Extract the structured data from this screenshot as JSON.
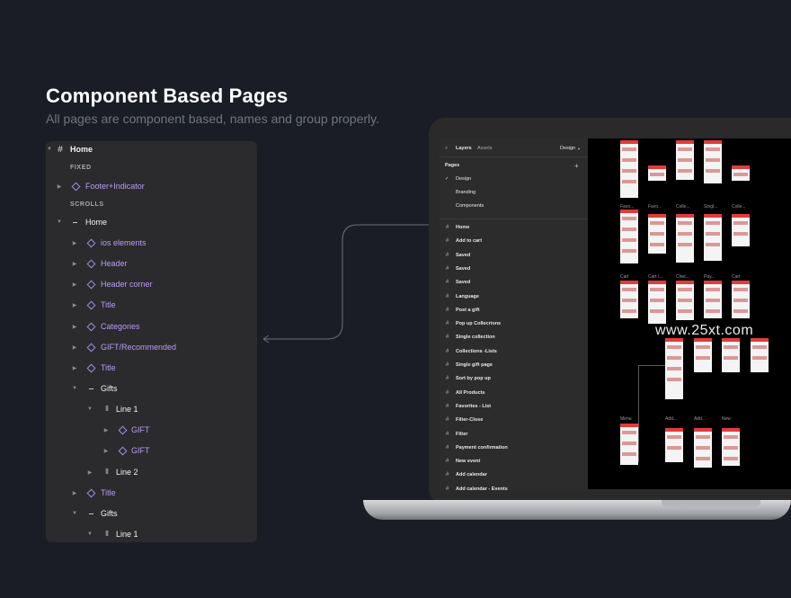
{
  "header": {
    "title": "Component Based Pages",
    "subtitle": "All pages are component based,  names and group properly."
  },
  "layers_panel": {
    "rows": [
      {
        "label": "Home",
        "style": "white-bold",
        "icon": "frame-icon"
      },
      {
        "label": "FIXED",
        "style": "section"
      },
      {
        "label": "Footer+Indicator",
        "style": "purple",
        "icon": "component-icon"
      },
      {
        "label": "SCROLLS",
        "style": "section"
      },
      {
        "label": "Home",
        "style": "white",
        "icon": "list-layout-icon"
      },
      {
        "label": "ios elements",
        "style": "purple",
        "icon": "component-icon"
      },
      {
        "label": "Header",
        "style": "purple",
        "icon": "component-icon"
      },
      {
        "label": "Header corner",
        "style": "purple",
        "icon": "component-icon"
      },
      {
        "label": "Title",
        "style": "purple",
        "icon": "component-icon"
      },
      {
        "label": "Categories",
        "style": "purple",
        "icon": "component-icon"
      },
      {
        "label": "GIFT/Recommended",
        "style": "purple",
        "icon": "component-icon"
      },
      {
        "label": "Title",
        "style": "purple",
        "icon": "component-icon"
      },
      {
        "label": "Gifts",
        "style": "white",
        "icon": "list-layout-icon"
      },
      {
        "label": "Line 1",
        "style": "white",
        "icon": "columns-icon"
      },
      {
        "label": "GIFT",
        "style": "purple",
        "icon": "component-icon"
      },
      {
        "label": "GIFT",
        "style": "purple",
        "icon": "component-icon"
      },
      {
        "label": "Line 2",
        "style": "white",
        "icon": "columns-icon"
      },
      {
        "label": "Title",
        "style": "purple",
        "icon": "component-icon"
      },
      {
        "label": "Gifts",
        "style": "white",
        "icon": "list-layout-icon"
      },
      {
        "label": "Line 1",
        "style": "white",
        "icon": "columns-icon"
      }
    ]
  },
  "figma": {
    "tabs": {
      "layers": "Layers",
      "assets": "Assets",
      "design": "Design"
    },
    "pages_title": "Pages",
    "add": "+",
    "pages": [
      "Design",
      "Branding",
      "Components"
    ],
    "frames": [
      "Home",
      "Add to cart",
      "Saved",
      "Saved",
      "Saved",
      "Language",
      "Post a gift",
      "Pop up Collecrions",
      "Single collection",
      "Collections -Lists",
      "Single gift page",
      "Sort by pop up",
      "All Products",
      "Favorites - List",
      "Filter-Close",
      "Filter",
      "Payment confirmation",
      "New event",
      "Add calendar",
      "Add calendar - Events"
    ],
    "canvas_labels": [
      "Favo...",
      "Favo...",
      "Colle...",
      "Singl...",
      "Colle...",
      "Cart",
      "Cart /...",
      "Chec...",
      "Pay...",
      "Cart",
      "Menu",
      "Add...",
      "Add...",
      "New"
    ]
  },
  "watermark": "www.25xt.com",
  "colors": {
    "background": "#1b1d26",
    "panel": "#2b2b2d",
    "accent_purple": "#b99cf5",
    "accent_red": "#e23b3b"
  }
}
